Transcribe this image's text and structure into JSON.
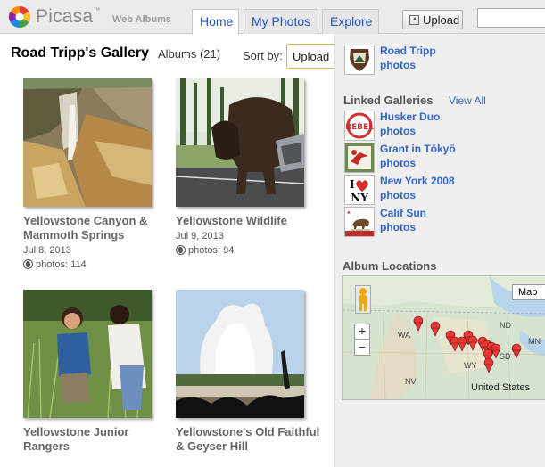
{
  "header": {
    "app_name": "Picasa",
    "trademark": "™",
    "subtitle": "Web Albums",
    "tabs": [
      {
        "label": "Home",
        "active": true
      },
      {
        "label": "My Photos",
        "active": false
      },
      {
        "label": "Explore",
        "active": false
      }
    ],
    "upload_label": "Upload",
    "search_value": ""
  },
  "gallery": {
    "title": "Road Tripp's Gallery",
    "albums_count": "Albums (21)",
    "sort_label": "Sort by:",
    "sort_value": "Upload"
  },
  "albums": [
    {
      "title": "Yellowstone Canyon & Mammoth Springs",
      "date": "Jul 8, 2013",
      "count": "photos: 114"
    },
    {
      "title": "Yellowstone Wildlife",
      "date": "Jul 9, 2013",
      "count": "photos: 94"
    },
    {
      "title": "Yellowstone Junior Rangers",
      "date": "",
      "count": ""
    },
    {
      "title": "Yellowstone's Old Faithful & Geyser Hill",
      "date": "",
      "count": ""
    }
  ],
  "sidebar": {
    "owner": {
      "name": "Road Tripp",
      "photos_label": "photos",
      "icon": "nps-arrowhead-icon"
    },
    "linked_heading": "Linked Galleries",
    "view_all": "View All",
    "linked": [
      {
        "name": "Husker Duo",
        "photos_label": "photos",
        "icon": "rebel-logo-icon"
      },
      {
        "name": "Grant in Tōkyō",
        "photos_label": "photos",
        "icon": "crane-icon"
      },
      {
        "name": "New York 2008",
        "photos_label": "photos",
        "icon": "i-love-ny-icon"
      },
      {
        "name": "Calif Sun",
        "photos_label": "photos",
        "icon": "california-flag-icon"
      }
    ],
    "locations_heading": "Album Locations",
    "map": {
      "type_label": "Map",
      "zoom_in": "+",
      "zoom_out": "−",
      "labels": [
        "WA",
        "ND",
        "MN",
        "SD",
        "WY",
        "NV",
        "United States"
      ],
      "pin_color": "#e53935"
    }
  },
  "colors": {
    "link": "#3366cc",
    "header_bg": "#ebebeb",
    "sidebar_bg": "#efefef"
  }
}
